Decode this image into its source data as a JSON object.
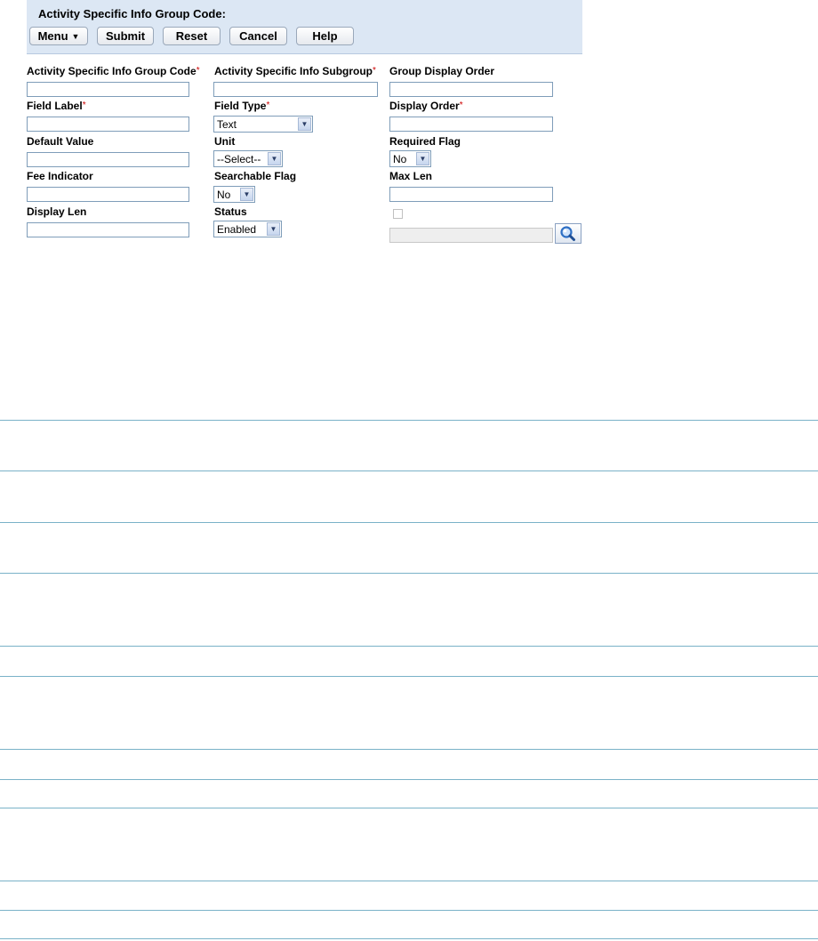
{
  "header": {
    "title": "Activity Specific Info Group Code:",
    "buttons": {
      "menu": "Menu",
      "submit": "Submit",
      "reset": "Reset",
      "cancel": "Cancel",
      "help": "Help"
    }
  },
  "form": {
    "group_code": {
      "label": "Activity Specific Info Group Code",
      "value": ""
    },
    "subgroup": {
      "label": "Activity Specific Info Subgroup",
      "value": ""
    },
    "group_display_order": {
      "label": "Group Display Order",
      "value": ""
    },
    "field_label": {
      "label": "Field Label",
      "value": ""
    },
    "field_type": {
      "label": "Field Type",
      "selected": "Text"
    },
    "display_order": {
      "label": "Display Order",
      "value": ""
    },
    "default_value": {
      "label": "Default Value",
      "value": ""
    },
    "unit": {
      "label": "Unit",
      "selected": "--Select--"
    },
    "required_flag": {
      "label": "Required Flag",
      "selected": "No"
    },
    "fee_indicator": {
      "label": "Fee Indicator",
      "value": ""
    },
    "searchable_flag": {
      "label": "Searchable Flag",
      "selected": "No"
    },
    "max_len": {
      "label": "Max Len",
      "value": ""
    },
    "display_len": {
      "label": "Display Len",
      "value": ""
    },
    "status": {
      "label": "Status",
      "selected": "Enabled"
    },
    "lookup": {
      "checked": false,
      "value": ""
    }
  },
  "required_marker": "*",
  "icons": {
    "dropdown": "chevron-down-icon",
    "lookup": "magnifier-icon",
    "menu": "menu-arrow-icon"
  },
  "colors": {
    "header_bg": "#dce7f4",
    "required": "#cc0000",
    "divider": "#7ab2c8",
    "lookup_icon": "#2e6fc4"
  }
}
